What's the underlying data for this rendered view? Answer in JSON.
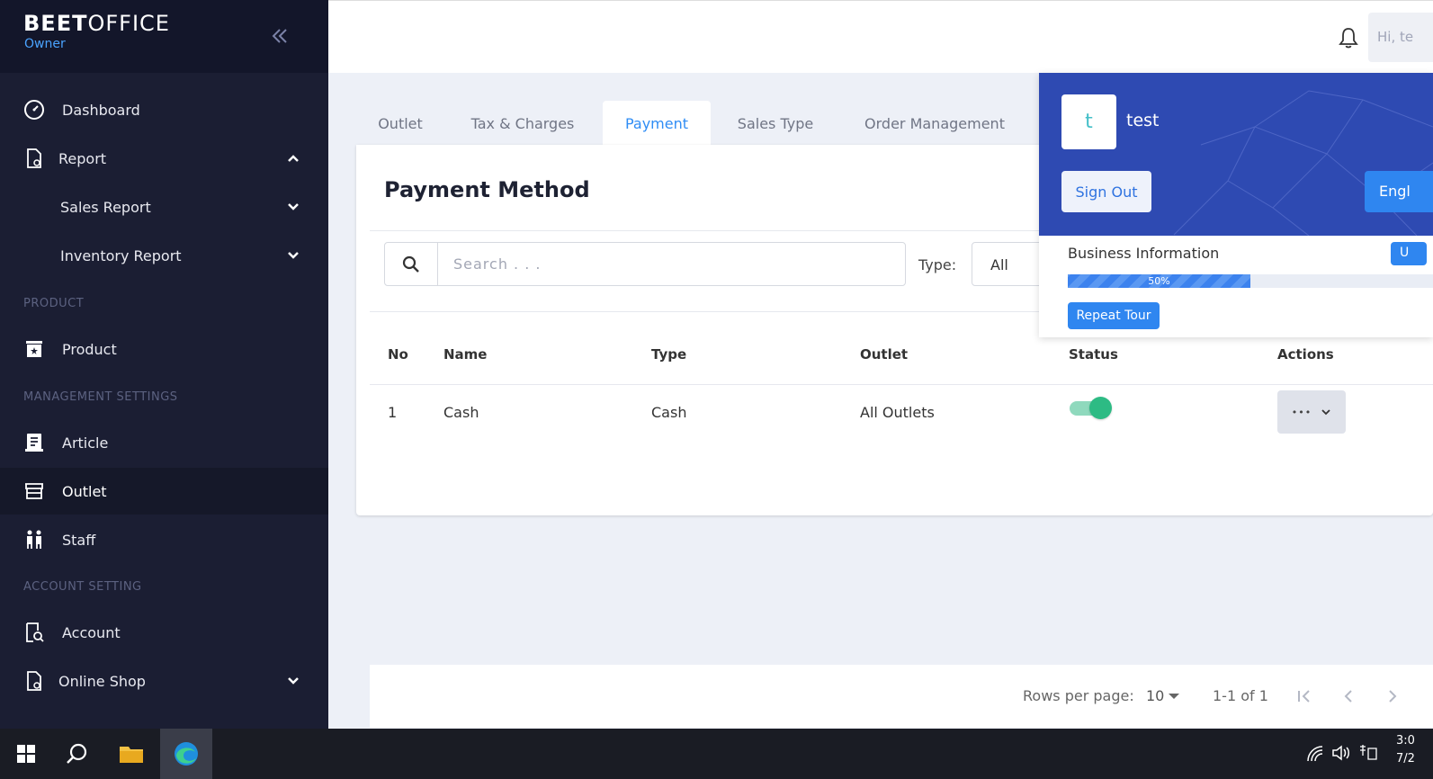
{
  "sidebar": {
    "brand_bold": "BEET",
    "brand_light": "OFFICE",
    "role": "Owner",
    "items": [
      {
        "label": "Dashboard"
      },
      {
        "label": "Report"
      },
      {
        "label": "Sales Report"
      },
      {
        "label": "Inventory Report"
      },
      {
        "label": "Product"
      },
      {
        "label": "Article"
      },
      {
        "label": "Outlet"
      },
      {
        "label": "Staff"
      },
      {
        "label": "Account"
      },
      {
        "label": "Online Shop"
      }
    ],
    "sections": [
      "PRODUCT",
      "MANAGEMENT SETTINGS",
      "ACCOUNT SETTING"
    ]
  },
  "header": {
    "greeting": "Hi, te"
  },
  "tabs": [
    "Outlet",
    "Tax & Charges",
    "Payment",
    "Sales Type",
    "Order Management"
  ],
  "main": {
    "title": "Payment Method",
    "search": {
      "placeholder": "Search . . ."
    },
    "type_label": "Type:",
    "type_value": "All",
    "columns": [
      "No",
      "Name",
      "Type",
      "Outlet",
      "Status",
      "Actions"
    ],
    "rows": [
      {
        "no": "1",
        "name": "Cash",
        "type": "Cash",
        "outlet": "All Outlets",
        "status": true
      }
    ],
    "actions_label": "•••"
  },
  "pagination": {
    "rows_per_page_label": "Rows per page:",
    "rows_per_page": "10",
    "range": "1-1 of 1"
  },
  "user_panel": {
    "avatar_letter": "t",
    "name": "test",
    "sign_out": "Sign Out",
    "language": "Engl",
    "business_info": "Business Information",
    "business_btn": "U",
    "progress_label": "50%",
    "progress": 0.5,
    "repeat_tour": "Repeat Tour"
  },
  "taskbar": {
    "time": "3:0",
    "date": "7/2"
  },
  "colors": {
    "sidebar_bg": "#1b1e33",
    "accent": "#2f86f0",
    "panel_bg": "#2e4ab2",
    "toggle_on": "#2dbb84"
  }
}
